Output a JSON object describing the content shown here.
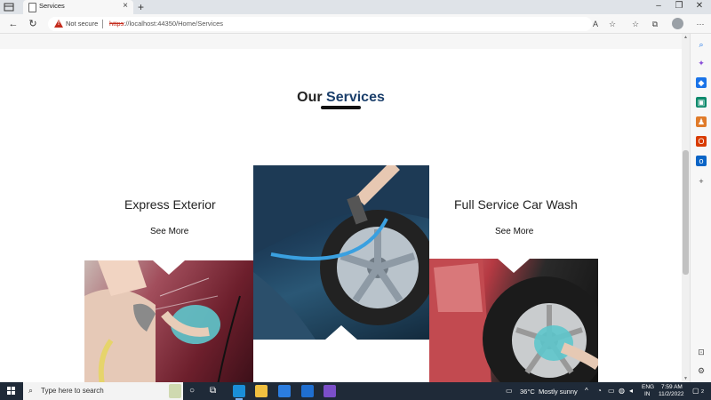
{
  "browser": {
    "tab_title": "Services",
    "not_secure_label": "Not secure",
    "url_scheme": "https",
    "url_rest": "://localhost:44350/Home/Services"
  },
  "page": {
    "heading_part1": "Our",
    "heading_part2": "Services",
    "services": [
      {
        "title": "Express Exterior",
        "link": "See More"
      },
      {
        "title": "Full Service Car Wash",
        "link": "See More"
      }
    ]
  },
  "taskbar": {
    "search_placeholder": "Type here to search",
    "weather_temp": "36°C",
    "weather_text": "Mostly sunny",
    "lang_line1": "ENG",
    "lang_line2": "IN",
    "time": "7:59 AM",
    "date": "11/2/2022",
    "notification_count": "2"
  },
  "colors": {
    "accent": "#1b3f6b",
    "warning": "#c42b1c",
    "taskbar": "#1f2a38"
  }
}
